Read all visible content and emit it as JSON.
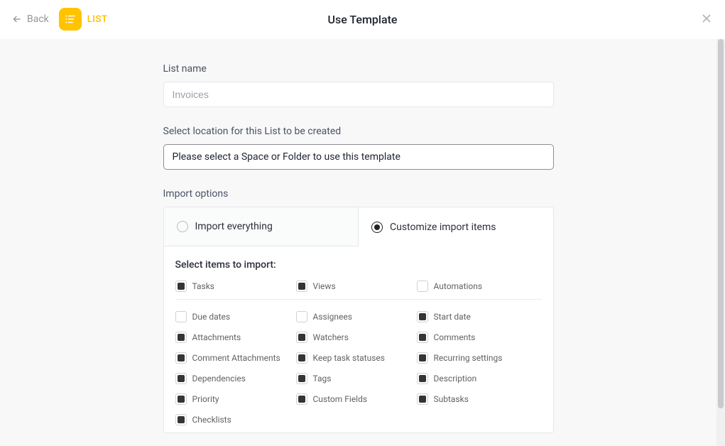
{
  "header": {
    "back_label": "Back",
    "list_badge_label": "LIST",
    "title": "Use Template"
  },
  "form": {
    "list_name_label": "List name",
    "list_name_placeholder": "Invoices",
    "location_label": "Select location for this List to be created",
    "location_placeholder": "Please select a Space or Folder to use this template"
  },
  "import": {
    "section_label": "Import options",
    "option_everything": "Import everything",
    "option_customize": "Customize import items",
    "selected": "customize",
    "items_label": "Select items to import:",
    "primary": [
      {
        "label": "Tasks",
        "checked": true
      },
      {
        "label": "Views",
        "checked": true
      },
      {
        "label": "Automations",
        "checked": false
      }
    ],
    "secondary_rows": [
      [
        {
          "label": "Due dates",
          "checked": false
        },
        {
          "label": "Assignees",
          "checked": false
        },
        {
          "label": "Start date",
          "checked": true
        }
      ],
      [
        {
          "label": "Attachments",
          "checked": true
        },
        {
          "label": "Watchers",
          "checked": true
        },
        {
          "label": "Comments",
          "checked": true
        }
      ],
      [
        {
          "label": "Comment Attachments",
          "checked": true
        },
        {
          "label": "Keep task statuses",
          "checked": true
        },
        {
          "label": "Recurring settings",
          "checked": true
        }
      ],
      [
        {
          "label": "Dependencies",
          "checked": true
        },
        {
          "label": "Tags",
          "checked": true
        },
        {
          "label": "Description",
          "checked": true
        }
      ],
      [
        {
          "label": "Priority",
          "checked": true
        },
        {
          "label": "Custom Fields",
          "checked": true
        },
        {
          "label": "Subtasks",
          "checked": true
        }
      ],
      [
        {
          "label": "Checklists",
          "checked": true
        }
      ]
    ]
  }
}
